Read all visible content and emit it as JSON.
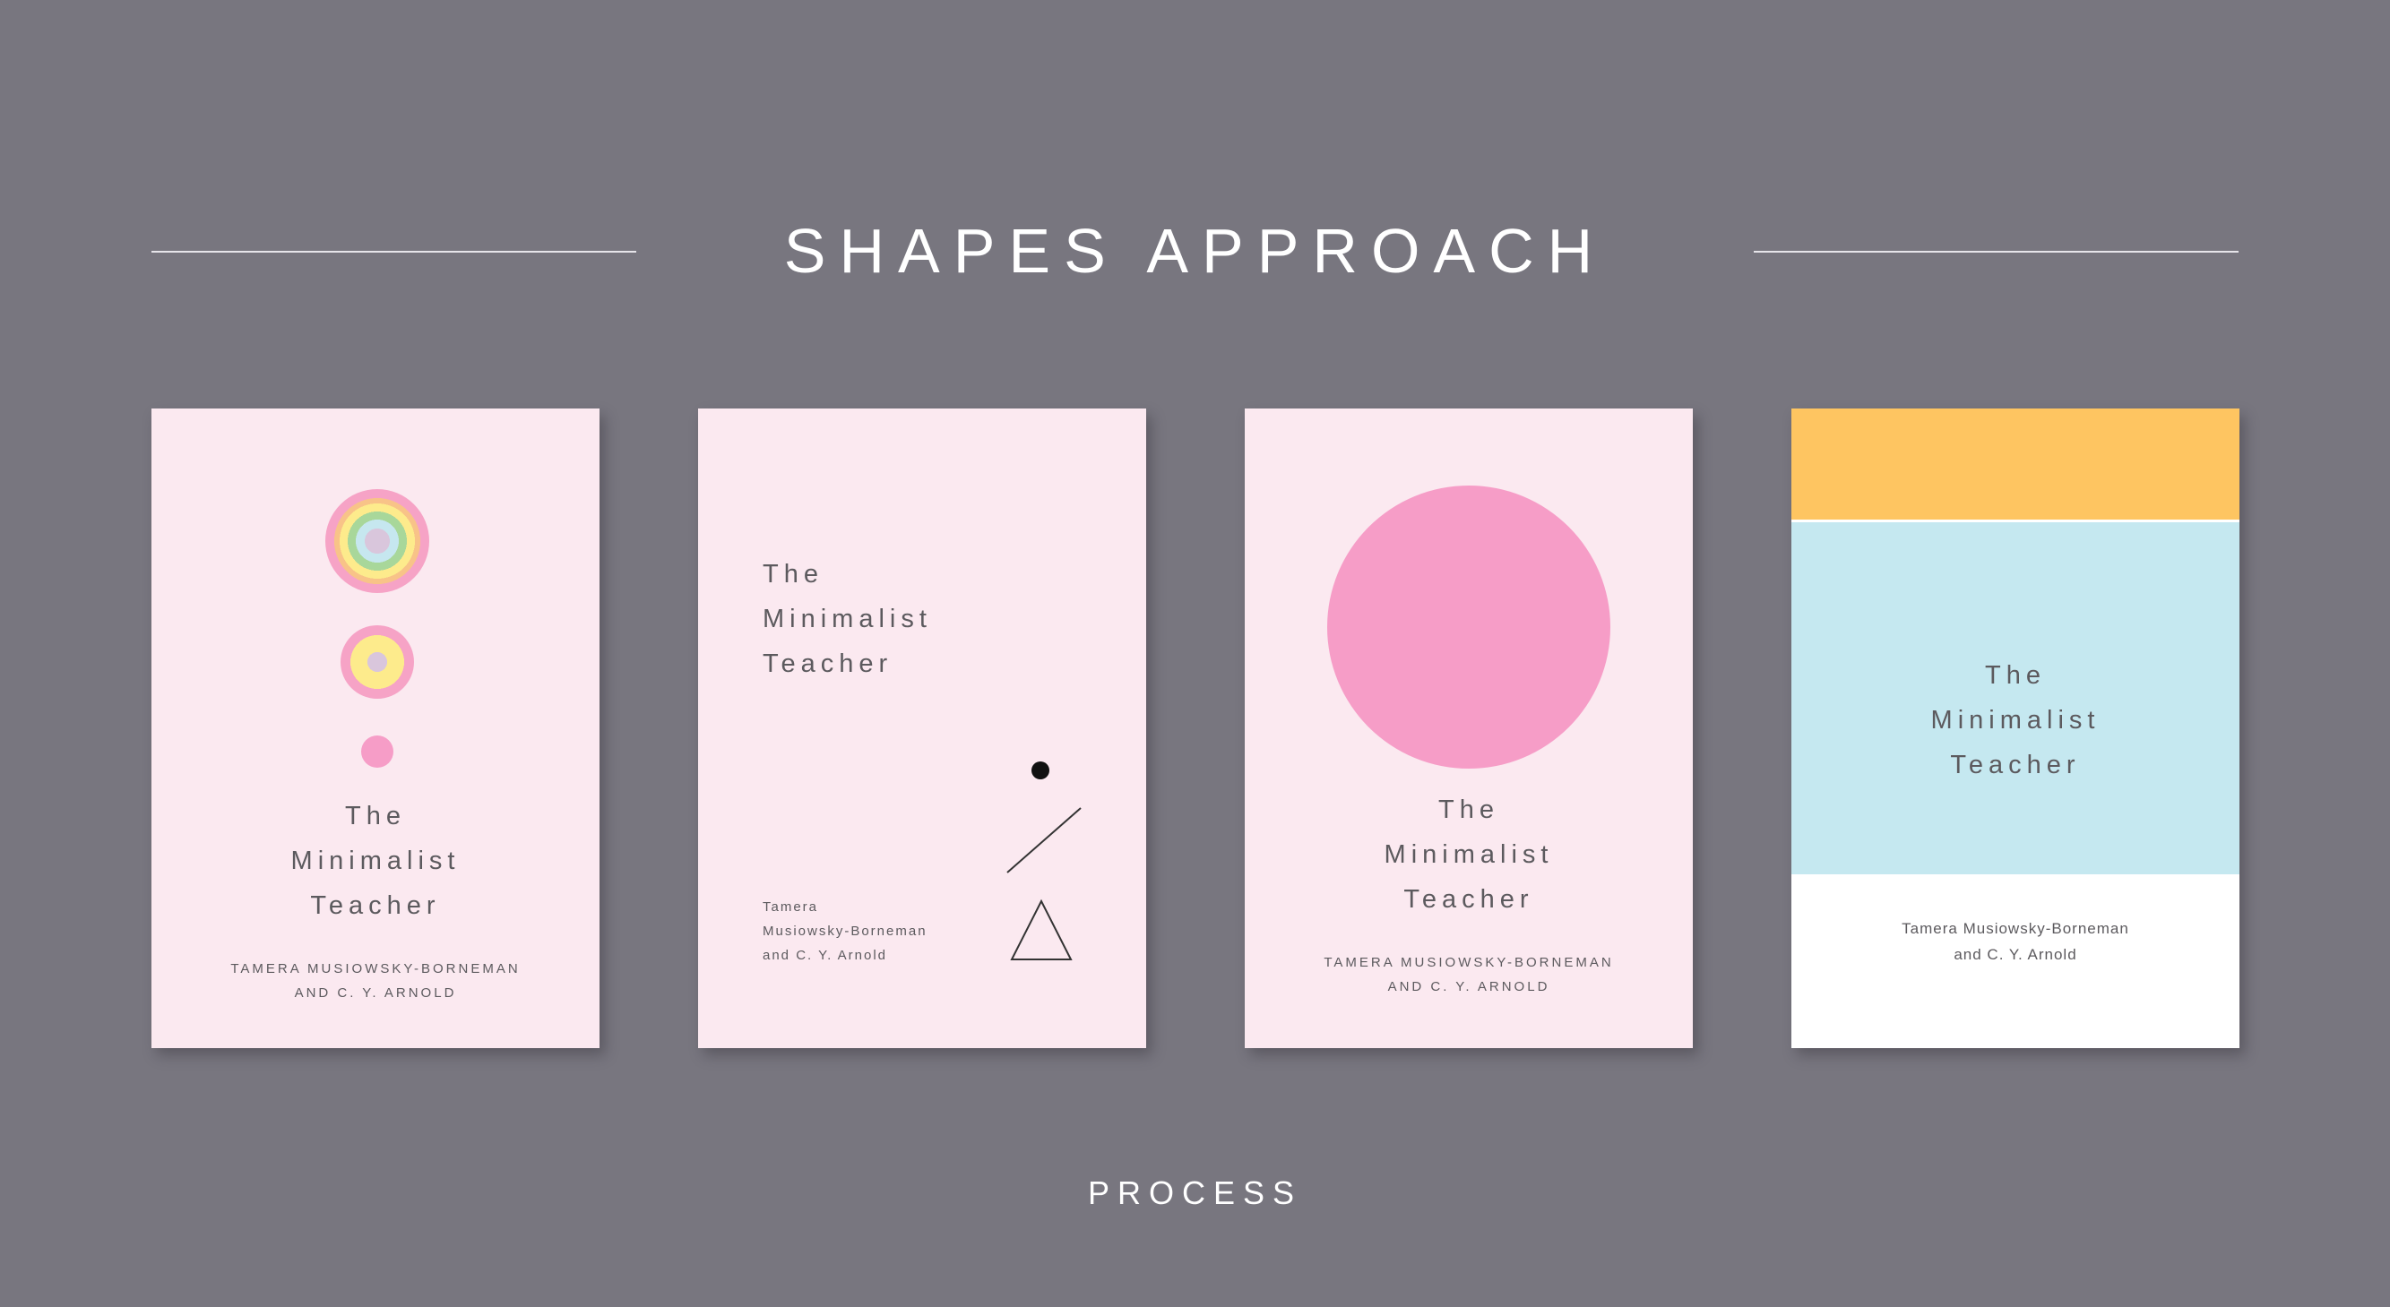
{
  "heading": "SHAPES APPROACH",
  "footer": "PROCESS",
  "covers": [
    {
      "title_lines": [
        "The",
        "Minimalist",
        "Teacher"
      ],
      "author_lines": [
        "TAMERA MUSIOWSKY-BORNEMAN",
        "AND C. Y. ARNOLD"
      ]
    },
    {
      "title_lines": [
        "The",
        "Minimalist",
        "Teacher"
      ],
      "author_lines": [
        "Tamera",
        "Musiowsky-Borneman",
        "and C. Y. Arnold"
      ]
    },
    {
      "title_lines": [
        "The",
        "Minimalist",
        "Teacher"
      ],
      "author_lines": [
        "TAMERA MUSIOWSKY-BORNEMAN",
        "AND C. Y. ARNOLD"
      ]
    },
    {
      "title_lines": [
        "The",
        "Minimalist",
        "Teacher"
      ],
      "author_lines": [
        "Tamera Musiowsky-Borneman",
        "and C. Y. Arnold"
      ]
    }
  ],
  "colors": {
    "background": "#78767f",
    "cover_pink": "#fbe9f0",
    "circle_pink": "#f69dc7",
    "band_orange": "#fec561",
    "band_blue": "#c5e8f0",
    "text_gray": "#5c5a5e"
  }
}
